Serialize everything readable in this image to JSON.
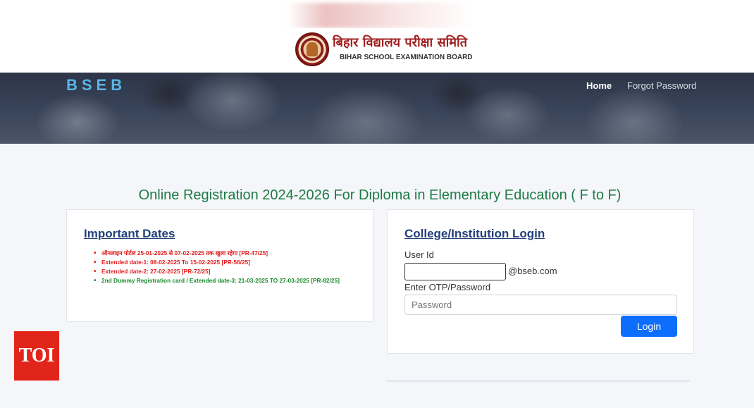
{
  "header": {
    "org_name_hindi": "बिहार विद्यालय परीक्षा समिति",
    "org_name_english": "BIHAR SCHOOL EXAMINATION BOARD",
    "logo_icon": "bseb-emblem-icon"
  },
  "navbar": {
    "brand": "BSEB",
    "links": [
      {
        "label": "Home"
      },
      {
        "label": "Forgot Password"
      }
    ]
  },
  "page_title": "Online Registration 2024-2026 For Diploma in Elementary Education ( F to F)",
  "important_dates": {
    "heading": "Important Dates",
    "items": [
      {
        "text": "ऑनलाइन पोर्टल 25-01-2025 से 07-02-2025 तक खुला रहेगा [PR-47/25]",
        "color": "#e21b1b"
      },
      {
        "text": "Extended date-1: 08-02-2025 To 15-02-2025 [PR-56/25]",
        "color": "#e21b1b"
      },
      {
        "text": "Extended date-2: 27-02-2025 [PR-72/25]",
        "color": "#e21b1b"
      },
      {
        "text": "2nd Dummy Registration card / Extended date-3: 21-03-2025 TO 27-03-2025 [PR-82/25]",
        "color": "#1b8a2a"
      }
    ]
  },
  "login": {
    "heading": "College/Institution Login",
    "user_id_label": "User Id",
    "user_id_value": "",
    "domain_suffix": "@bseb.com",
    "password_label": "Enter OTP/Password",
    "password_placeholder": "Password",
    "button_label": "Login"
  },
  "watermark": {
    "label": "TOI"
  },
  "colors": {
    "brand_blue": "#5bb4e6",
    "title_green": "#1e7a46",
    "heading_navy": "#23407a",
    "button_blue": "#0d6efd",
    "alert_red": "#e21b1b",
    "success_green": "#1b8a2a",
    "toi_red": "#e1251b"
  }
}
